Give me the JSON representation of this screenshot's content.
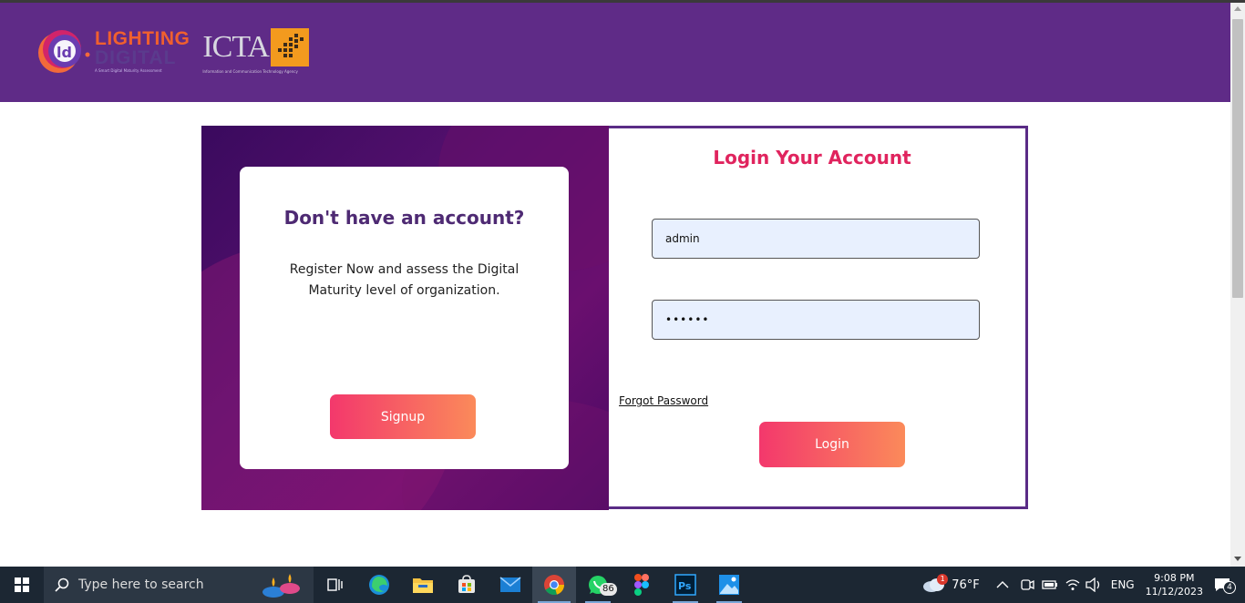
{
  "header": {
    "brand_line1": "LIGHTING",
    "brand_line2": "DIGITAL",
    "brand_tagline": "A Smart Digital Maturity Assessment",
    "partner_logo": "ICTA",
    "partner_subtitle": "Information and Communication Technology Agency",
    "background": "#5f2b87"
  },
  "register_card": {
    "title": "Don't have an account?",
    "text": "Register Now and assess the Digital Maturity level of organization.",
    "signup_label": "Signup"
  },
  "login_form": {
    "title": "Login Your Account",
    "username_value": "admin",
    "password_value": "••••••",
    "forgot_label": "Forgot Password",
    "login_label": "Login",
    "accent": "#e0245e"
  },
  "taskbar": {
    "search_placeholder": "Type here to search",
    "apps": [
      "task-view-icon",
      "edge-icon",
      "file-explorer-icon",
      "store-icon",
      "mail-icon",
      "chrome-icon",
      "whatsapp-icon",
      "figma-icon",
      "photoshop-icon",
      "photos-icon"
    ],
    "whatsapp_badge": "86",
    "weather_badge": "1",
    "weather_temp": "76°F",
    "language": "ENG",
    "time": "9:08 PM",
    "date": "11/12/2023",
    "notification_count": "4"
  }
}
